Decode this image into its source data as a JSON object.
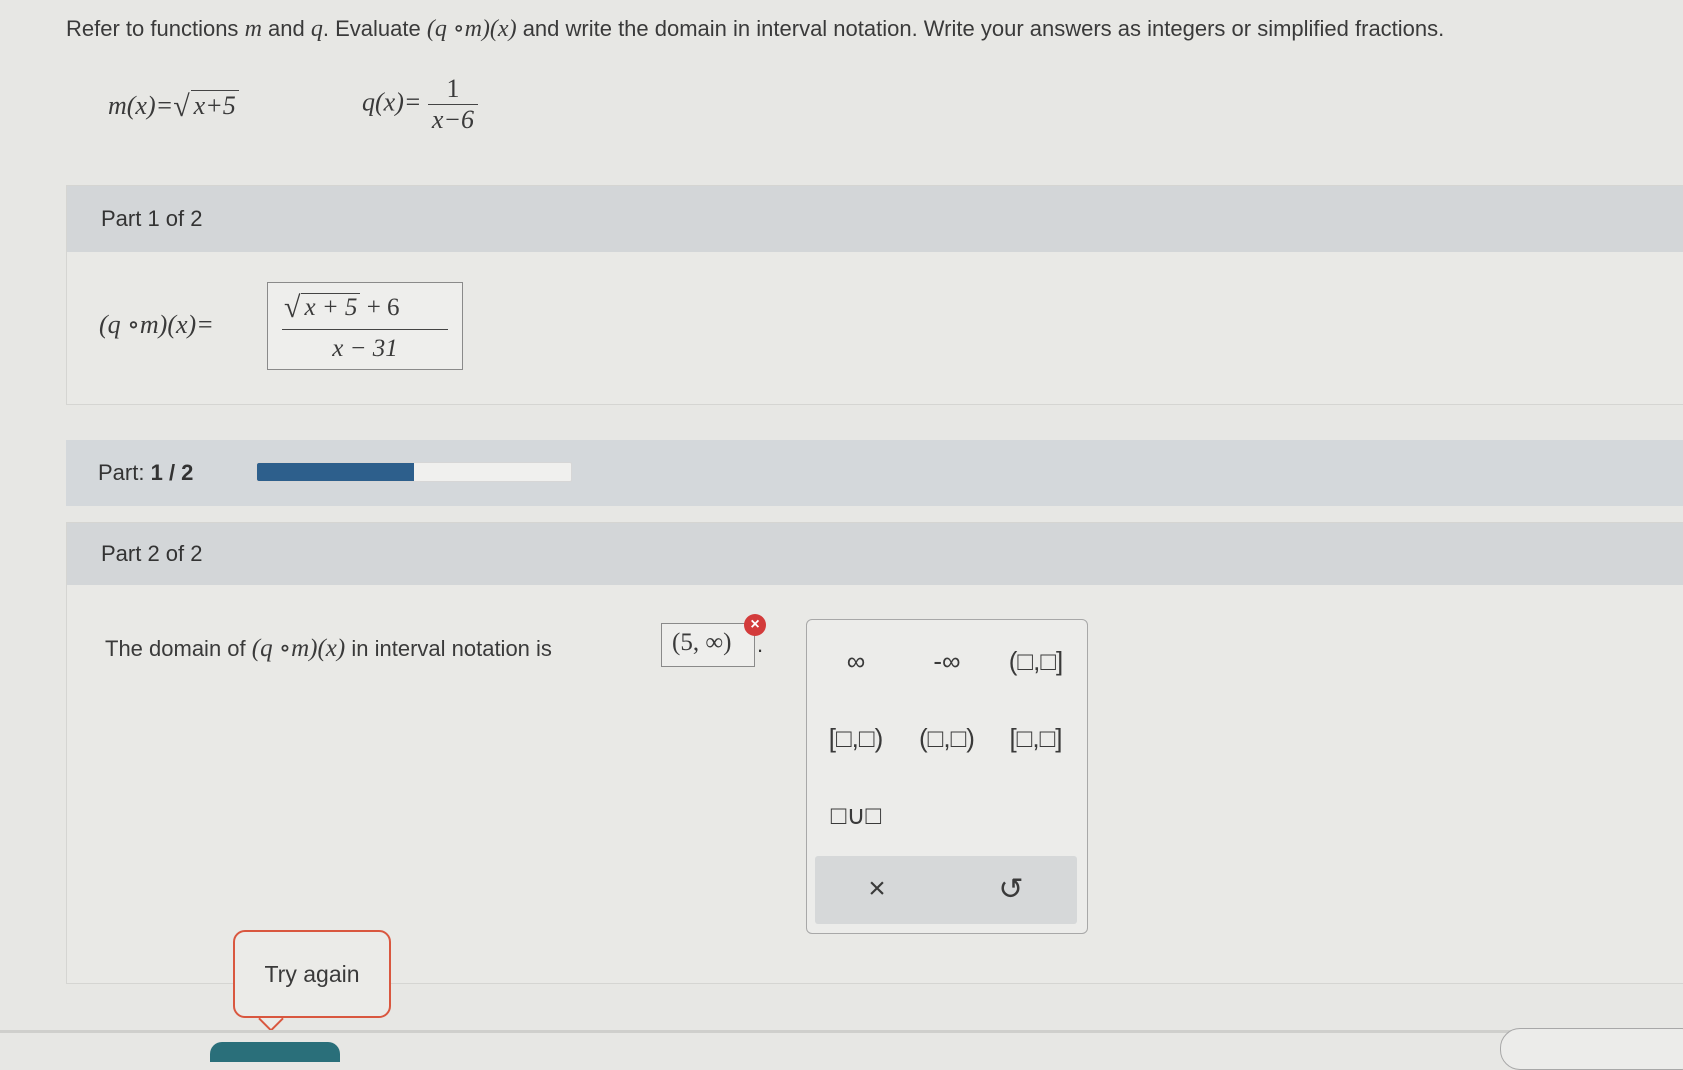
{
  "prompt": {
    "text_before": "Refer to functions",
    "var_m": "m",
    "and": "and",
    "var_q": "q",
    "text_eval": ". Evaluate",
    "composition": "(q ∘m)(x)",
    "text_after": "and write the domain in interval notation. Write your answers as integers or simplified fractions."
  },
  "functions": {
    "m_lhs": "m(x)=",
    "m_radicand": "x+5",
    "q_lhs": "q(x)=",
    "q_numerator": "1",
    "q_denominator": "x−6"
  },
  "part1": {
    "header": "Part 1 of 2",
    "lhs": "(q ∘m)(x)=",
    "answer_radicand": "x + 5",
    "answer_num_rest": "+ 6",
    "answer_denominator": "x − 31"
  },
  "progress": {
    "label": "Part:",
    "value_text": "1 / 2",
    "fraction": 0.5
  },
  "part2": {
    "header": "Part 2 of 2",
    "sentence_before": "The domain of",
    "composition": "(q ∘m)(x)",
    "sentence_after": "in interval notation is",
    "answer": "(5, ∞)",
    "period": ".",
    "error_mark": "×"
  },
  "keypad": {
    "keys_row1": [
      "∞",
      "-∞",
      "(□,□]"
    ],
    "keys_row2": [
      "[□,□)",
      "(□,□)",
      "[□,□]"
    ],
    "keys_row3": [
      "□∪□"
    ],
    "clear": "×",
    "undo": "↺"
  },
  "feedback": {
    "try_again": "Try again"
  },
  "colors": {
    "progress_fill": "#2d5f8c",
    "error": "#d33b3b",
    "tooltip_border": "#d9573f"
  }
}
